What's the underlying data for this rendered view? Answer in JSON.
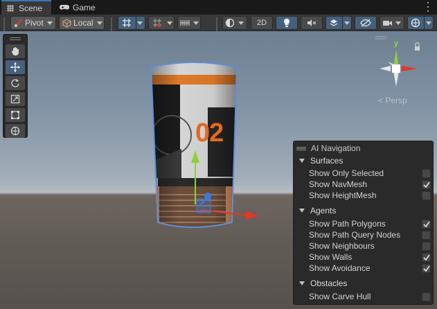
{
  "tabs": [
    {
      "label": "Scene",
      "icon": "scene-grid-icon",
      "active": true
    },
    {
      "label": "Game",
      "icon": "gamepad-icon",
      "active": false
    }
  ],
  "toolbar": {
    "pivot_label": "Pivot",
    "local_label": "Local",
    "mode_2d_label": "2D"
  },
  "tool_palette": [
    "hand-tool-icon",
    "move-tool-icon",
    "rotate-tool-icon",
    "scale-tool-icon",
    "rect-tool-icon",
    "transform-tool-icon"
  ],
  "gizmo": {
    "y_label": "y",
    "persp_label": "< Persp"
  },
  "ai_navigation": {
    "title": "AI Navigation",
    "sections": [
      {
        "title": "Surfaces",
        "options": [
          {
            "label": "Show Only Selected",
            "checked": false
          },
          {
            "label": "Show NavMesh",
            "checked": true
          },
          {
            "label": "Show HeightMesh",
            "checked": false
          }
        ]
      },
      {
        "title": "Agents",
        "options": [
          {
            "label": "Show Path Polygons",
            "checked": true
          },
          {
            "label": "Show Path Query Nodes",
            "checked": false
          },
          {
            "label": "Show Neighbours",
            "checked": false
          },
          {
            "label": "Show Walls",
            "checked": true
          },
          {
            "label": "Show Avoidance",
            "checked": true
          }
        ]
      },
      {
        "title": "Obstacles",
        "options": [
          {
            "label": "Show Carve Hull",
            "checked": false
          }
        ]
      }
    ]
  },
  "barrel": {
    "label": "02"
  },
  "colors": {
    "accent": "#46607c",
    "tab_highlight": "#3a79bb",
    "axis_x": "#e0382a",
    "axis_y": "#8ed23b",
    "axis_z": "#3a7be0"
  }
}
